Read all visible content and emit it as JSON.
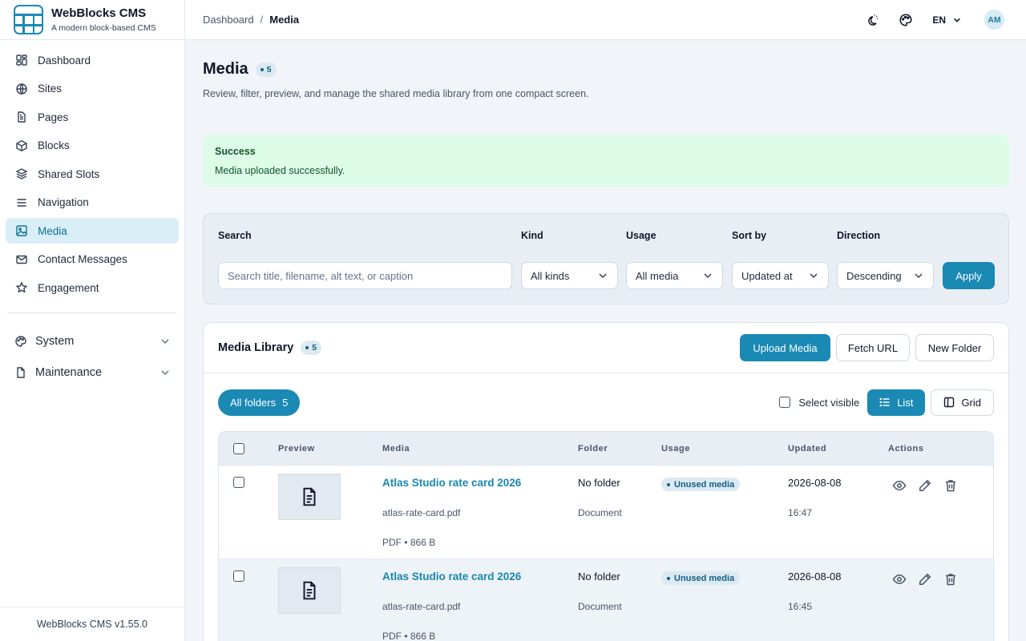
{
  "brand": {
    "title": "WebBlocks CMS",
    "subtitle": "A modern block-based CMS"
  },
  "sidebar": {
    "items": [
      {
        "label": "Dashboard",
        "icon": "dashboard-icon"
      },
      {
        "label": "Sites",
        "icon": "globe-icon"
      },
      {
        "label": "Pages",
        "icon": "page-icon"
      },
      {
        "label": "Blocks",
        "icon": "cube-icon"
      },
      {
        "label": "Shared Slots",
        "icon": "layers-icon"
      },
      {
        "label": "Navigation",
        "icon": "menu-icon"
      },
      {
        "label": "Media",
        "icon": "image-icon",
        "active": true
      },
      {
        "label": "Contact Messages",
        "icon": "mail-icon"
      },
      {
        "label": "Engagement",
        "icon": "star-icon"
      }
    ],
    "groups": [
      {
        "label": "System",
        "icon": "palette-icon"
      },
      {
        "label": "Maintenance",
        "icon": "file-icon"
      }
    ],
    "footer": "WebBlocks CMS v1.55.0"
  },
  "header": {
    "breadcrumb": [
      "Dashboard",
      "Media"
    ],
    "breadcrumb_sep": "/",
    "lang": "EN",
    "avatar": "AM"
  },
  "page": {
    "title": "Media",
    "count": "5",
    "description": "Review, filter, preview, and manage the shared media library from one compact screen."
  },
  "alert": {
    "title": "Success",
    "message": "Media uploaded successfully."
  },
  "filters": {
    "search_label": "Search",
    "search_placeholder": "Search title, filename, alt text, or caption",
    "kind_label": "Kind",
    "kind_value": "All kinds",
    "usage_label": "Usage",
    "usage_value": "All media",
    "sort_label": "Sort by",
    "sort_value": "Updated at",
    "direction_label": "Direction",
    "direction_value": "Descending",
    "apply_label": "Apply"
  },
  "library": {
    "title": "Media Library",
    "count": "5",
    "upload_label": "Upload Media",
    "fetch_label": "Fetch URL",
    "new_folder_label": "New Folder",
    "folder_chip_label": "All folders",
    "folder_chip_count": "5",
    "select_visible_label": "Select visible",
    "list_label": "List",
    "grid_label": "Grid",
    "columns": [
      "Preview",
      "Media",
      "Folder",
      "Usage",
      "Updated",
      "Actions"
    ],
    "rows": [
      {
        "title": "Atlas Studio rate card 2026",
        "filename": "atlas-rate-card.pdf",
        "meta": "PDF • 866 B",
        "folder": "No folder",
        "kind": "Document",
        "usage": "Unused media",
        "date": "2026-08-08",
        "time": "16:47"
      },
      {
        "title": "Atlas Studio rate card 2026",
        "filename": "atlas-rate-card.pdf",
        "meta": "PDF • 866 B",
        "folder": "No folder",
        "kind": "Document",
        "usage": "Unused media",
        "date": "2026-08-08",
        "time": "16:45"
      }
    ]
  },
  "colors": {
    "accent": "#1a89b4",
    "success_bg": "#dcfce7",
    "active_nav_bg": "#d9eef6"
  }
}
